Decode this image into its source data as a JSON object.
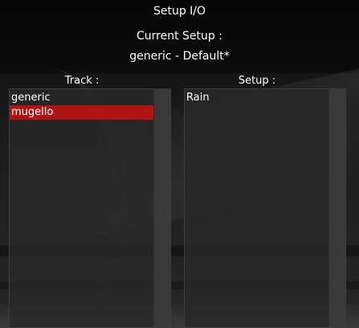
{
  "window": {
    "title": "Setup I/O"
  },
  "current_setup": {
    "label": "Current Setup :",
    "value": "generic - Default*"
  },
  "track_list": {
    "header": "Track :",
    "items": [
      {
        "label": "generic",
        "selected": false
      },
      {
        "label": "mugello",
        "selected": true
      }
    ]
  },
  "setup_list": {
    "header": "Setup :",
    "items": [
      {
        "label": "Rain",
        "selected": false
      }
    ]
  },
  "colors": {
    "selection": "#b01414",
    "text": "#ffffff",
    "list_bg": "#282828"
  }
}
